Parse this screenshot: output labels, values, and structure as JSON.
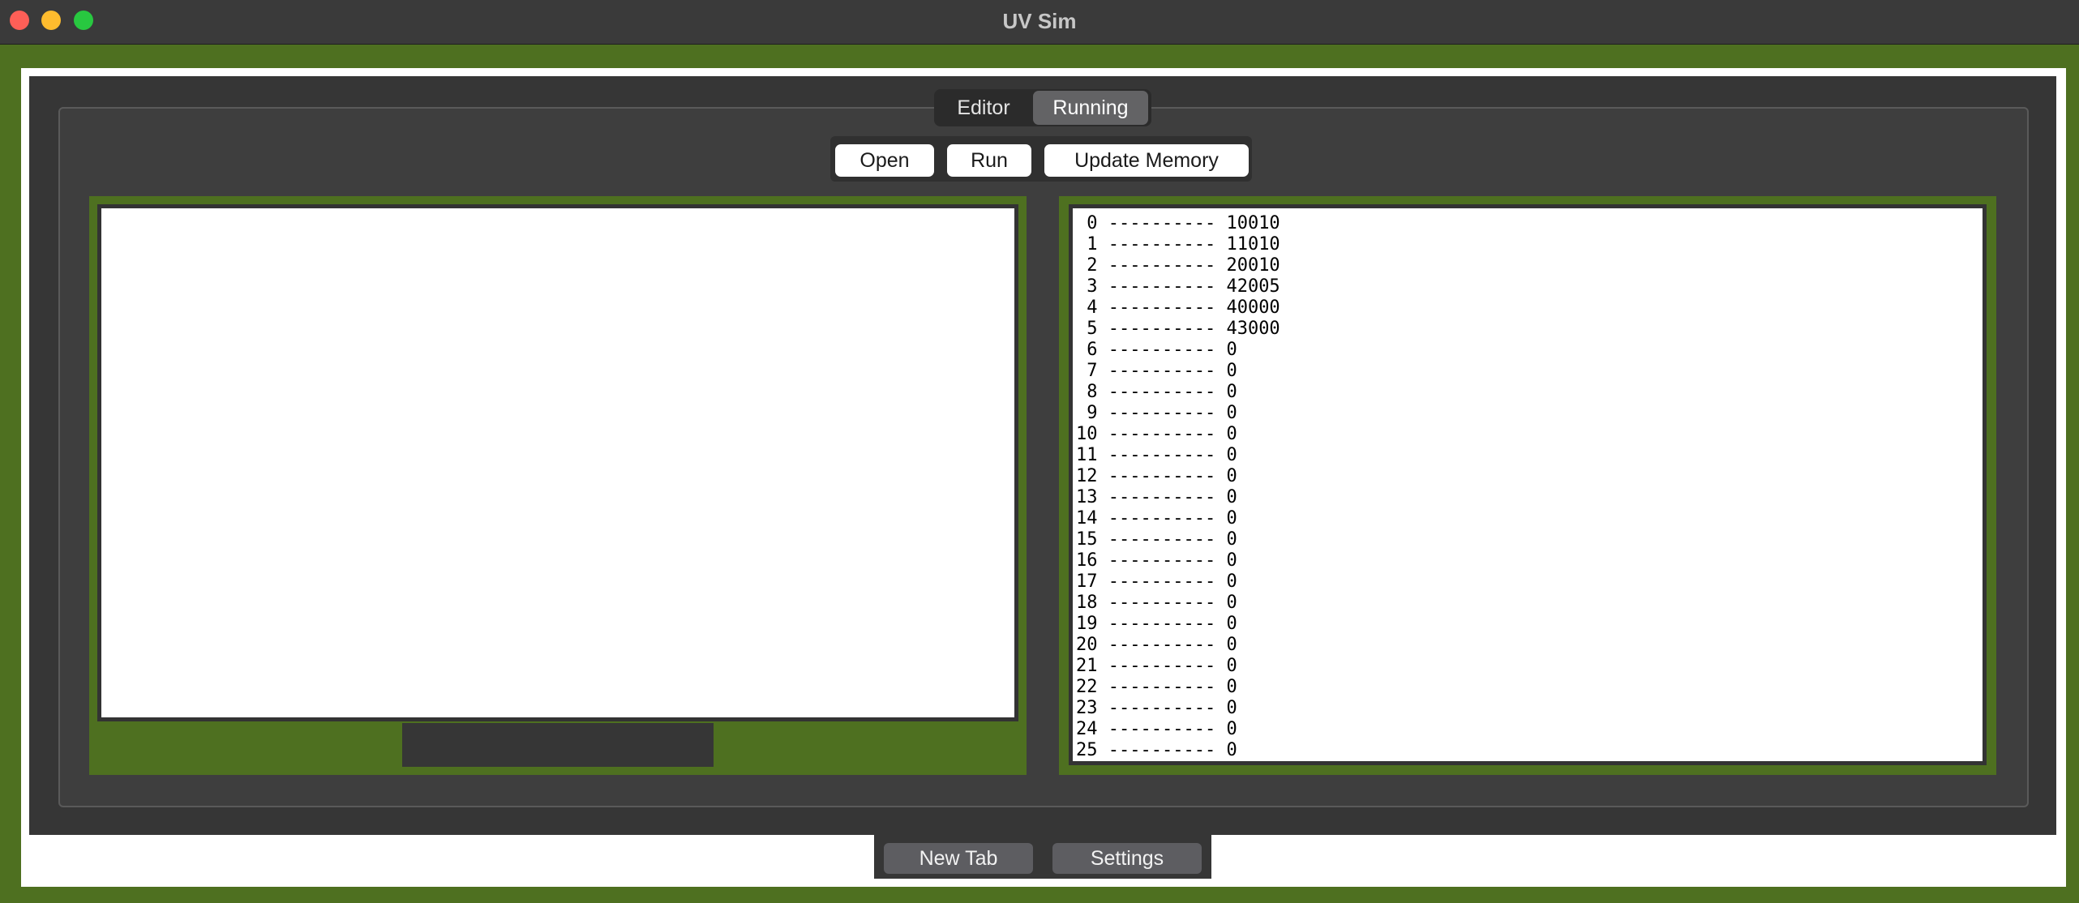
{
  "window": {
    "title": "UV Sim"
  },
  "tabs": {
    "editor": "Editor",
    "running": "Running",
    "selected": "Running"
  },
  "toolbar": {
    "open_label": "Open",
    "run_label": "Run",
    "update_memory_label": "Update Memory"
  },
  "memory": {
    "rows": [
      {
        "address": "0",
        "value": "10010"
      },
      {
        "address": "1",
        "value": "11010"
      },
      {
        "address": "2",
        "value": "20010"
      },
      {
        "address": "3",
        "value": "42005"
      },
      {
        "address": "4",
        "value": "40000"
      },
      {
        "address": "5",
        "value": "43000"
      },
      {
        "address": "6",
        "value": "0"
      },
      {
        "address": "7",
        "value": "0"
      },
      {
        "address": "8",
        "value": "0"
      },
      {
        "address": "9",
        "value": "0"
      },
      {
        "address": "10",
        "value": "0"
      },
      {
        "address": "11",
        "value": "0"
      },
      {
        "address": "12",
        "value": "0"
      },
      {
        "address": "13",
        "value": "0"
      },
      {
        "address": "14",
        "value": "0"
      },
      {
        "address": "15",
        "value": "0"
      },
      {
        "address": "16",
        "value": "0"
      },
      {
        "address": "17",
        "value": "0"
      },
      {
        "address": "18",
        "value": "0"
      },
      {
        "address": "19",
        "value": "0"
      },
      {
        "address": "20",
        "value": "0"
      },
      {
        "address": "21",
        "value": "0"
      },
      {
        "address": "22",
        "value": "0"
      },
      {
        "address": "23",
        "value": "0"
      },
      {
        "address": "24",
        "value": "0"
      },
      {
        "address": "25",
        "value": "0"
      }
    ]
  },
  "bottom_bar": {
    "new_tab_label": "New Tab",
    "settings_label": "Settings"
  },
  "colors": {
    "frame_green": "#4e7020",
    "panel_dark": "#363636",
    "titlebar": "#3a3a3a",
    "close": "#fe5f57",
    "minimize": "#febc2e",
    "zoom": "#28c840"
  }
}
